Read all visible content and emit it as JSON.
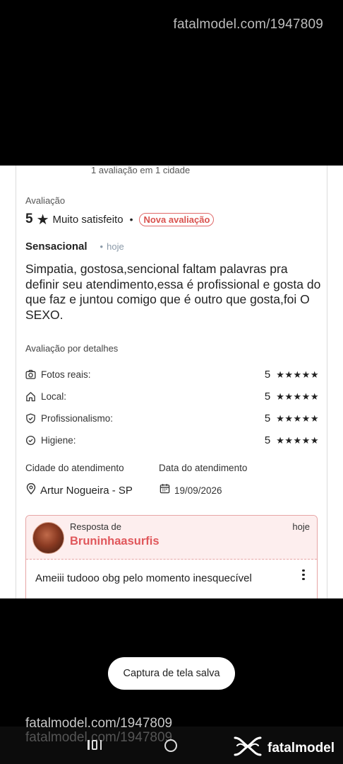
{
  "watermark": {
    "top": "fatalmodel.com/1947809",
    "bottom": "fatalmodel.com/1947809",
    "ghost": "fatalmodel.com/1947809"
  },
  "reviewer": {
    "summary": "1 avaliação em 1 cidade"
  },
  "review": {
    "section_label": "Avaliação",
    "rating": "5",
    "rating_star": "★",
    "rating_text": "Muito satisfeito",
    "separator": "•",
    "badge": "Nova avaliação",
    "title": "Sensacional",
    "time": "hoje",
    "body": "Simpatia, gostosa,sencional faltam palavras pra definir seu atendimento,essa é profissional e gosta do que faz e juntou comigo que é outro que gosta,foi O SEXO."
  },
  "details": {
    "label": "Avaliação por detalhes",
    "items": [
      {
        "label": "Fotos reais:",
        "icon": "camera-check-icon",
        "score": "5",
        "stars": "★★★★★"
      },
      {
        "label": "Local:",
        "icon": "home-icon",
        "score": "5",
        "stars": "★★★★★"
      },
      {
        "label": "Profissionalismo:",
        "icon": "shield-check-icon",
        "score": "5",
        "stars": "★★★★★"
      },
      {
        "label": "Higiene:",
        "icon": "circle-check-icon",
        "score": "5",
        "stars": "★★★★★"
      }
    ]
  },
  "service": {
    "city_label": "Cidade do atendimento",
    "city": "Artur Nogueira - SP",
    "date_label": "Data do atendimento",
    "date": "19/09/2026"
  },
  "response": {
    "label": "Resposta de",
    "name": "Bruninhaasurfis",
    "time": "hoje",
    "body": "Ameiii tudooo obg pelo momento inesquecível"
  },
  "toast": {
    "text": "Captura de tela salva"
  },
  "brand": {
    "name": "fatalmodel"
  },
  "colors": {
    "accent": "#e0575b",
    "badge_border": "#e06a6a",
    "response_bg": "#fdeeee"
  }
}
